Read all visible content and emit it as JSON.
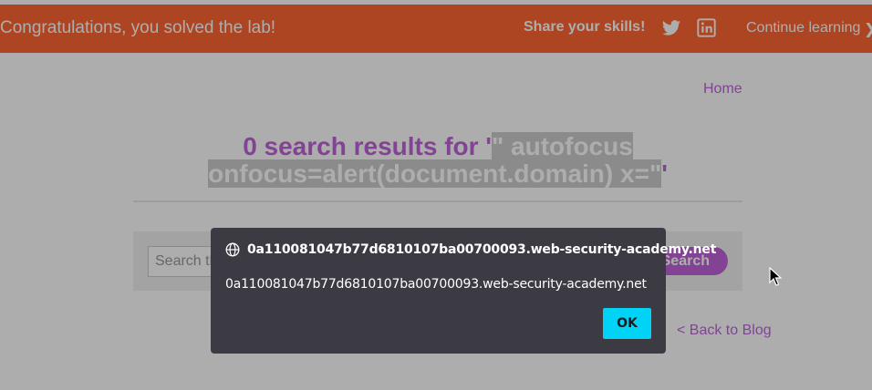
{
  "banner": {
    "message": "Congratulations, you solved the lab!",
    "share_label": "Share your skills!",
    "continue_label": "Continue learning",
    "continue_chevron": "❯",
    "icons": [
      "twitter-icon",
      "linkedin-icon"
    ],
    "color": "#ff6633"
  },
  "nav": {
    "home_label": "Home"
  },
  "results": {
    "prefix": "0 search results for '",
    "query_selected": "\" autofocus onfocus=alert(document.domain) x=\"",
    "suffix": "'"
  },
  "search": {
    "placeholder": "Search the blog...",
    "button_label": "Search"
  },
  "footer": {
    "back_label": "< Back to Blog"
  },
  "dialog": {
    "origin": "0a110081047b77d6810107ba00700093.web-security-academy.net",
    "message": "0a110081047b77d6810107ba00700093.web-security-academy.net",
    "ok_label": "OK",
    "icon": "globe-icon"
  },
  "colors": {
    "accent": "#c163db",
    "banner": "#ff6633",
    "ok_button": "#00d3f5",
    "dialog_bg": "#3c3b44"
  }
}
